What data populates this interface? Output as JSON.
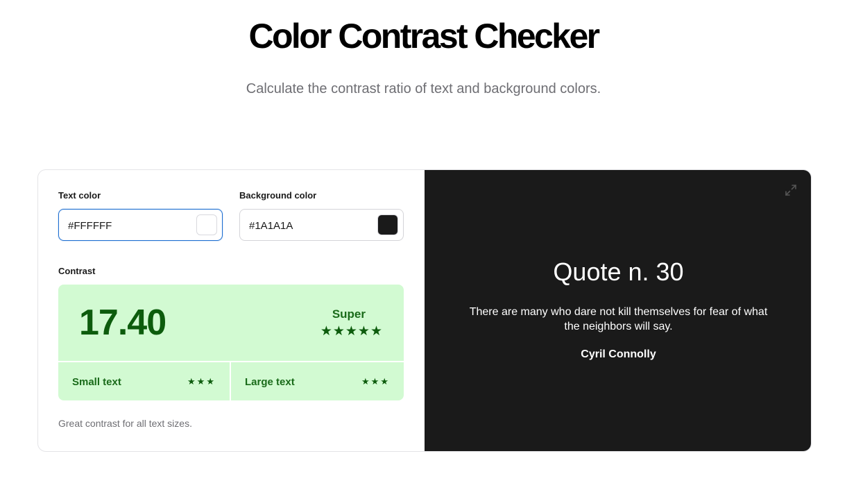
{
  "header": {
    "title": "Color Contrast Checker",
    "subtitle": "Calculate the contrast ratio of text and background colors."
  },
  "inputs": {
    "text_color": {
      "label": "Text color",
      "value": "#FFFFFF",
      "swatch": "#FFFFFF"
    },
    "background_color": {
      "label": "Background color",
      "value": "#1A1A1A",
      "swatch": "#1A1A1A"
    }
  },
  "contrast": {
    "label": "Contrast",
    "ratio": "17.40",
    "rating": "Super",
    "stars": "★★★★★",
    "small_text": {
      "label": "Small text",
      "stars": "★★★"
    },
    "large_text": {
      "label": "Large text",
      "stars": "★★★"
    },
    "hint": "Great contrast for all text sizes."
  },
  "preview": {
    "title": "Quote n. 30",
    "quote": "There are many who dare not kill themselves for fear of what the neighbors will say.",
    "author": "Cyril Connolly",
    "expand_icon": "expand-icon"
  },
  "colors": {
    "accent_green": "#0D5C0D",
    "rating_bg": "#D2FAD2",
    "focus_blue": "#1F6FD1",
    "preview_bg": "#1A1A1A",
    "preview_text": "#FFFFFF"
  }
}
